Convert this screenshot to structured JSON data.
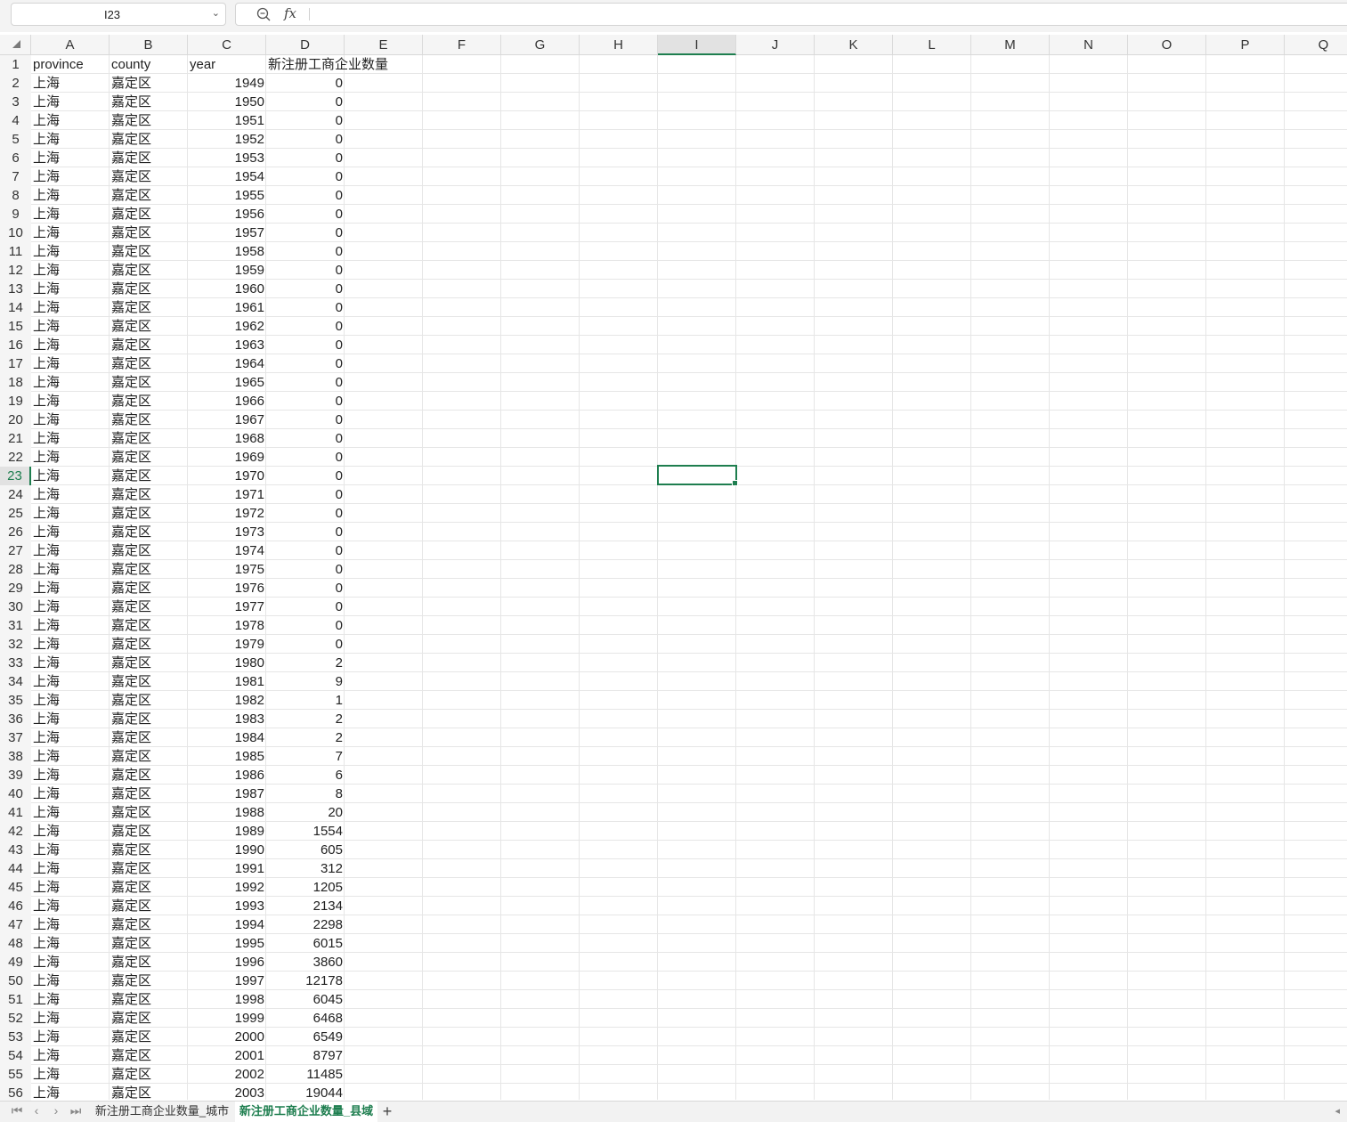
{
  "namebox": {
    "value": "I23"
  },
  "formula_bar": {
    "fx_label": "fx",
    "value": ""
  },
  "columns": [
    "A",
    "B",
    "C",
    "D",
    "E",
    "F",
    "G",
    "H",
    "I",
    "J",
    "K",
    "L",
    "M",
    "N",
    "O",
    "P",
    "Q"
  ],
  "active_column": "I",
  "active_row": 23,
  "headers": {
    "a": "province",
    "b": "county",
    "c": "year",
    "d": "新注册工商企业数量"
  },
  "province": "上海",
  "county": "嘉定区",
  "years": [
    1949,
    1950,
    1951,
    1952,
    1953,
    1954,
    1955,
    1956,
    1957,
    1958,
    1959,
    1960,
    1961,
    1962,
    1963,
    1964,
    1965,
    1966,
    1967,
    1968,
    1969,
    1970,
    1971,
    1972,
    1973,
    1974,
    1975,
    1976,
    1977,
    1978,
    1979,
    1980,
    1981,
    1982,
    1983,
    1984,
    1985,
    1986,
    1987,
    1988,
    1989,
    1990,
    1991,
    1992,
    1993,
    1994,
    1995,
    1996,
    1997,
    1998,
    1999,
    2000,
    2001,
    2002,
    2003
  ],
  "counts": [
    0,
    0,
    0,
    0,
    0,
    0,
    0,
    0,
    0,
    0,
    0,
    0,
    0,
    0,
    0,
    0,
    0,
    0,
    0,
    0,
    0,
    0,
    0,
    0,
    0,
    0,
    0,
    0,
    0,
    0,
    0,
    2,
    9,
    1,
    2,
    2,
    7,
    6,
    8,
    20,
    1554,
    605,
    312,
    1205,
    2134,
    2298,
    6015,
    3860,
    12178,
    6045,
    6468,
    6549,
    8797,
    11485,
    19044
  ],
  "sheet_tabs": [
    {
      "label": "新注册工商企业数量_城市",
      "active": false
    },
    {
      "label": "新注册工商企业数量_县域",
      "active": true
    }
  ],
  "add_tab_label": "+"
}
